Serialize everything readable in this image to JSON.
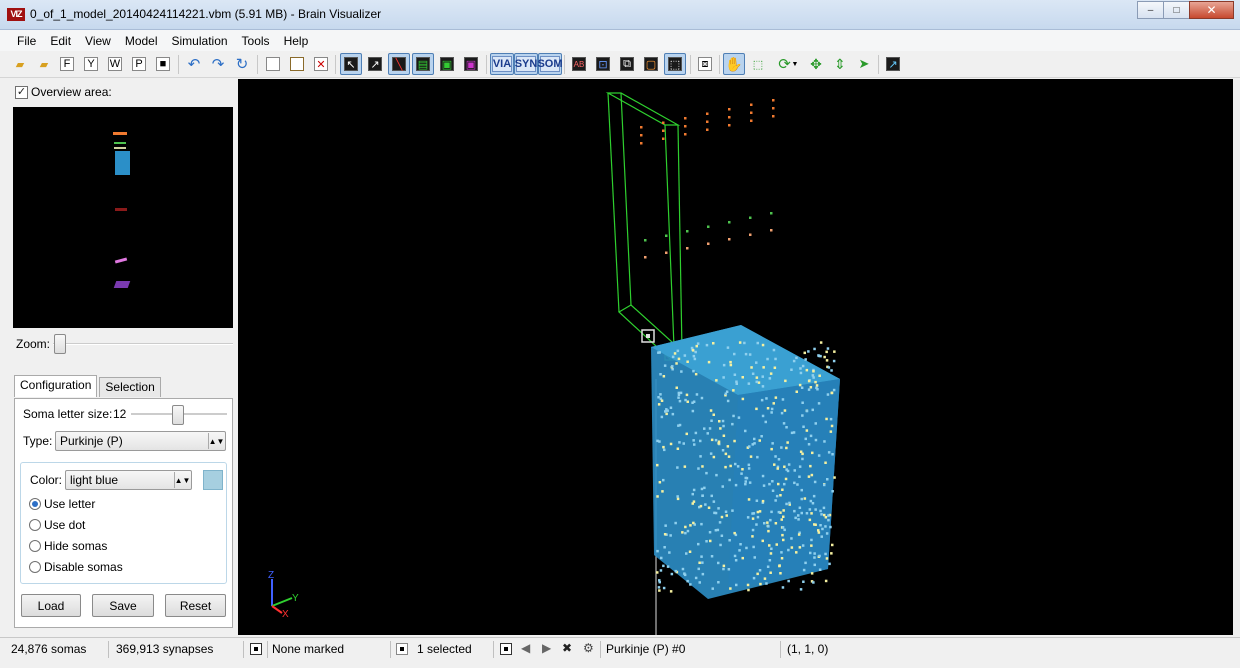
{
  "window": {
    "icon_text": "VIZ",
    "title": "0_of_1_model_20140424114221.vbm (5.91 MB) - Brain Visualizer",
    "minimize_glyph": "‒",
    "maximize_glyph": "□",
    "close_glyph": "✕"
  },
  "menu": [
    "File",
    "Edit",
    "View",
    "Model",
    "Simulation",
    "Tools",
    "Help"
  ],
  "toolbar": {
    "text_buttons": [
      "VIA",
      "SYN",
      "SOM"
    ]
  },
  "overview": {
    "checkbox_checked": true,
    "label": "Overview area:",
    "zoom_label": "Zoom:"
  },
  "tabs": [
    {
      "label": "Configuration",
      "active": true
    },
    {
      "label": "Selection",
      "active": false
    }
  ],
  "config": {
    "soma_letter_label": "Soma letter size:",
    "soma_letter_value": "12",
    "type_label": "Type:",
    "type_value": "Purkinje (P)",
    "color_label": "Color:",
    "color_value": "light blue",
    "swatch_color": "#a6cfe0",
    "options": [
      {
        "label": "Use letter",
        "selected": true
      },
      {
        "label": "Use dot",
        "selected": false
      },
      {
        "label": "Hide somas",
        "selected": false
      },
      {
        "label": "Disable somas",
        "selected": false
      }
    ],
    "buttons": {
      "load": "Load",
      "save": "Save",
      "reset": "Reset"
    }
  },
  "axes": {
    "z": "Z",
    "y": "Y",
    "x": "X"
  },
  "status": {
    "somas": "24,876 somas",
    "synapses": "369,913 synapses",
    "marked": "None marked",
    "selected": "1 selected",
    "current": "Purkinje (P) #0",
    "coords": "(1, 1, 0)"
  }
}
